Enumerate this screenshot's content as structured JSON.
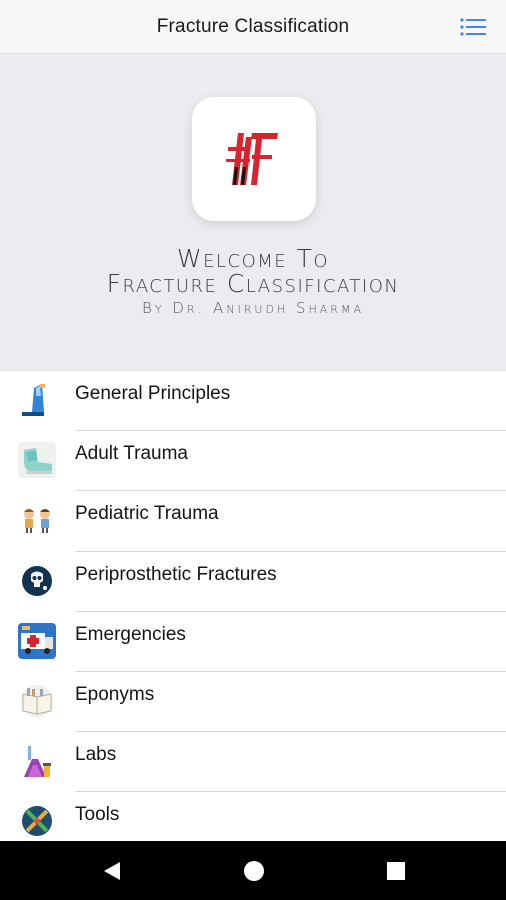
{
  "appbar": {
    "title": "Fracture Classification",
    "menu_icon": "list-menu-icon"
  },
  "hero": {
    "logo_icon": "ff-logo-icon",
    "welcome_line1": "Welcome To",
    "welcome_line2": "Fracture Classification",
    "byline": "By Dr. Anirudh Sharma"
  },
  "menu_items": [
    {
      "label": "General Principles",
      "icon": "bone-cast-icon"
    },
    {
      "label": "Adult Trauma",
      "icon": "foot-bandage-icon"
    },
    {
      "label": "Pediatric Trauma",
      "icon": "children-icon"
    },
    {
      "label": "Periprosthetic Fractures",
      "icon": "skull-xray-icon"
    },
    {
      "label": "Emergencies",
      "icon": "ambulance-icon"
    },
    {
      "label": "Eponyms",
      "icon": "book-icon"
    },
    {
      "label": "Labs",
      "icon": "lab-flask-icon"
    },
    {
      "label": "Tools",
      "icon": "tools-icon"
    }
  ],
  "navbar": {
    "back_icon": "back-triangle-icon",
    "home_icon": "home-circle-icon",
    "recent_icon": "recent-square-icon"
  },
  "colors": {
    "accent": "#2d7ff9",
    "logo_red": "#d7242e",
    "hero_bg": "#ecebef"
  }
}
